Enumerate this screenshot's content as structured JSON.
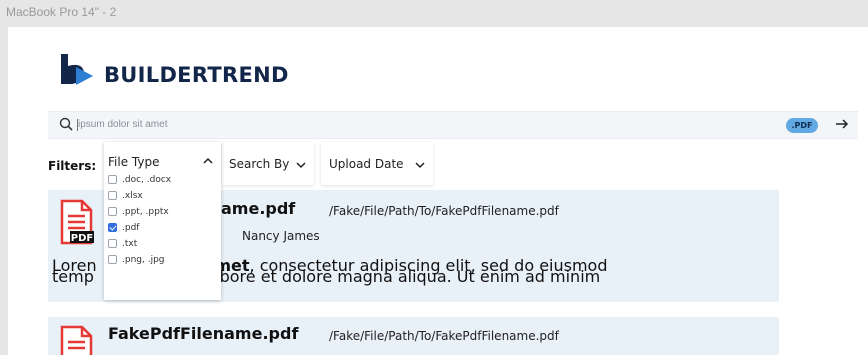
{
  "frame": {
    "title": "MacBook Pro 14\" - 2"
  },
  "brand": {
    "name": "BUILDERTREND",
    "colors": {
      "navy": "#12264a",
      "blue": "#2d7fd3"
    }
  },
  "search": {
    "placeholder": "ipsum dolor sit amet",
    "value": "",
    "chip_label": ".PDF",
    "icons": [
      "search-icon",
      "arrow-right-icon"
    ]
  },
  "filters": {
    "label": "Filters:",
    "file_type": {
      "label": "File Type",
      "expanded": true,
      "options": [
        {
          "label": ".doc, .docx",
          "checked": false
        },
        {
          "label": ".xlsx",
          "checked": false
        },
        {
          "label": ".ppt, .pptx",
          "checked": false
        },
        {
          "label": ".pdf",
          "checked": true
        },
        {
          "label": ".txt",
          "checked": false
        },
        {
          "label": ".png, .jpg",
          "checked": false
        }
      ]
    },
    "search_by": {
      "label": "Search By"
    },
    "upload_date": {
      "label": "Upload Date"
    }
  },
  "results": [
    {
      "filename": "FakePdfFilename.pdf",
      "filename_visible": "ame.pdf",
      "path": "/Fake/File/Path/To/FakePdfFilename.pdf",
      "author": "Nancy James",
      "icon_badge": "PDF",
      "snippet_line1_before": "Loren",
      "snippet_line1_bold": "sit amet",
      "snippet_line1_after": ", consectetur adipiscing elit, sed do eiusmod",
      "snippet_line2_before": "temp",
      "snippet_line2_after": "ut labore et dolore magna aliqua. Ut enim ad minim",
      "snippet_line1_mid": "r"
    },
    {
      "filename": "FakePdfFilename.pdf",
      "path": "/Fake/File/Path/To/FakePdfFilename.pdf"
    }
  ]
}
